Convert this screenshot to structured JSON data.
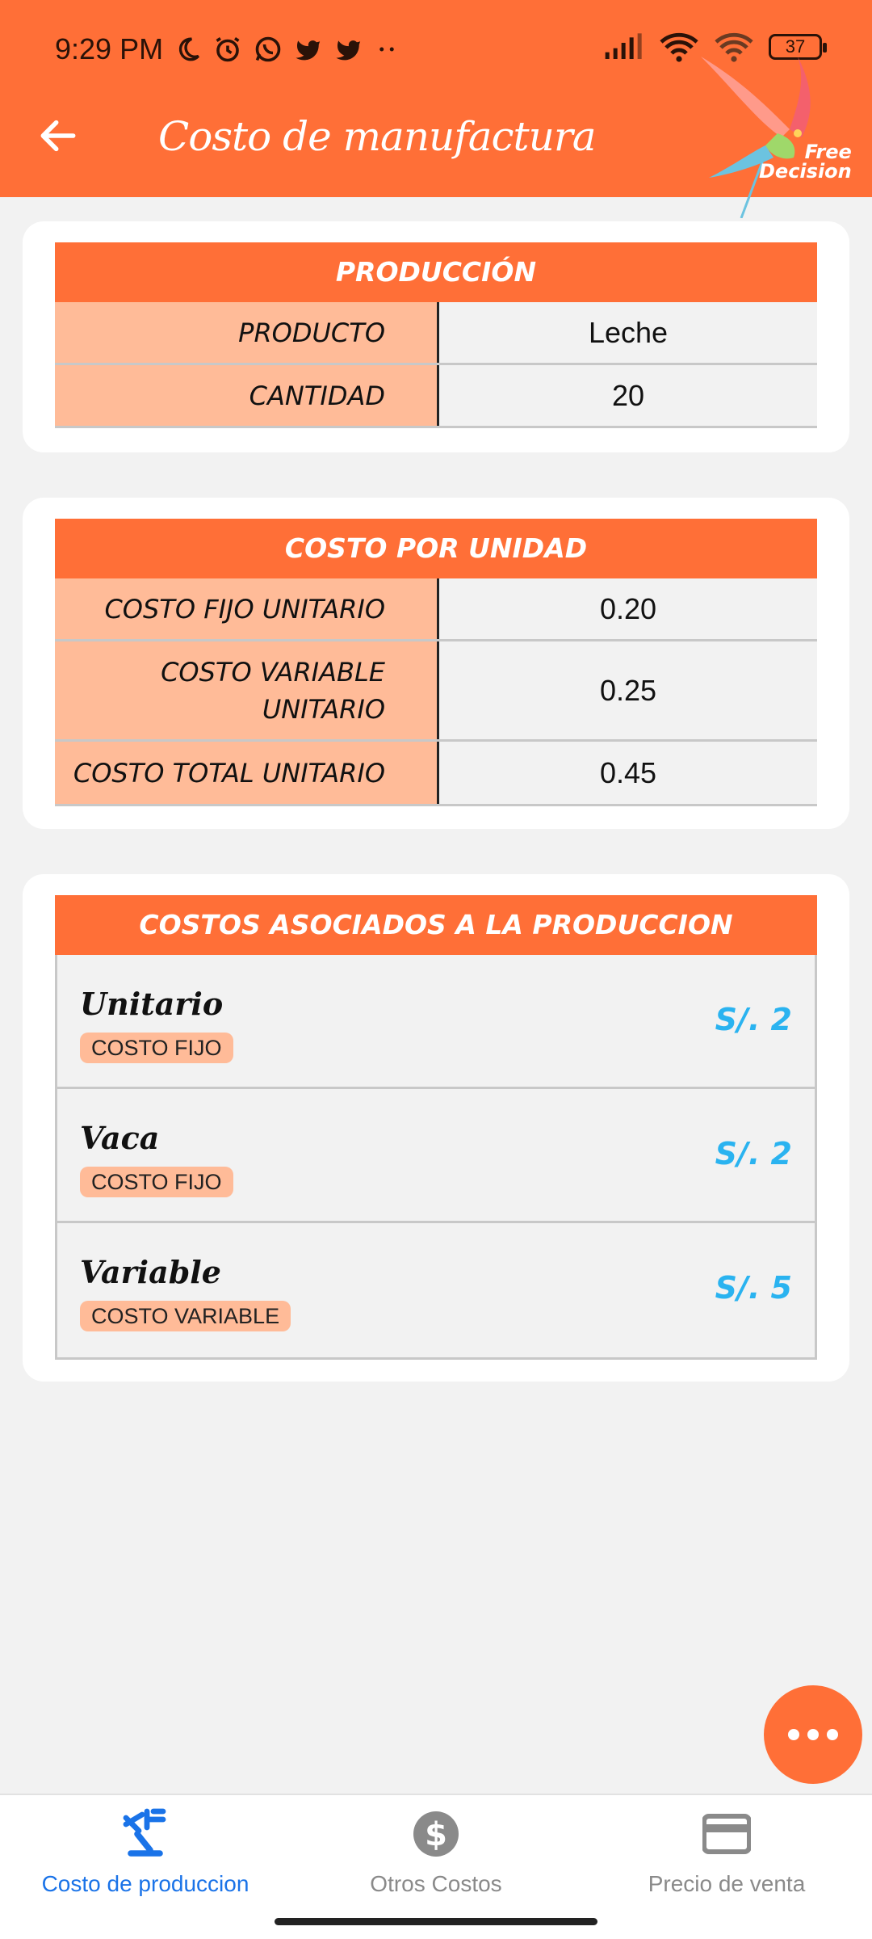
{
  "status_bar": {
    "time": "9:29 PM",
    "battery": "37"
  },
  "header": {
    "title": "Costo de manufactura",
    "logo_text_line1": "Free",
    "logo_text_line2": "Decision"
  },
  "produccion": {
    "heading": "PRODUCCIÓN",
    "rows": [
      {
        "label": "PRODUCTO",
        "value": "Leche"
      },
      {
        "label": "CANTIDAD",
        "value": "20"
      }
    ]
  },
  "costo_por_unidad": {
    "heading": "COSTO POR UNIDAD",
    "rows": [
      {
        "label": "COSTO FIJO UNITARIO",
        "value": "0.20"
      },
      {
        "label": "COSTO VARIABLE UNITARIO",
        "value": "0.25"
      },
      {
        "label": "COSTO TOTAL UNITARIO",
        "value": "0.45"
      }
    ]
  },
  "costos_asociados": {
    "heading": "COSTOS ASOCIADOS A LA PRODUCCION",
    "items": [
      {
        "name": "Unitario",
        "type": "COSTO FIJO",
        "price": "S/. 2"
      },
      {
        "name": "Vaca",
        "type": "COSTO FIJO",
        "price": "S/. 2"
      },
      {
        "name": "Variable",
        "type": "COSTO VARIABLE",
        "price": "S/. 5"
      }
    ]
  },
  "bottom_nav": {
    "items": [
      {
        "label": "Costo de produccion",
        "icon": "production-icon",
        "active": true
      },
      {
        "label": "Otros Costos",
        "icon": "dollar-circle-icon",
        "active": false
      },
      {
        "label": "Precio de venta",
        "icon": "credit-card-icon",
        "active": false
      }
    ]
  },
  "colors": {
    "accent": "#ff6f37",
    "label_bg": "#ffbb98",
    "price": "#2ab3f0",
    "nav_active": "#1a73e8"
  }
}
